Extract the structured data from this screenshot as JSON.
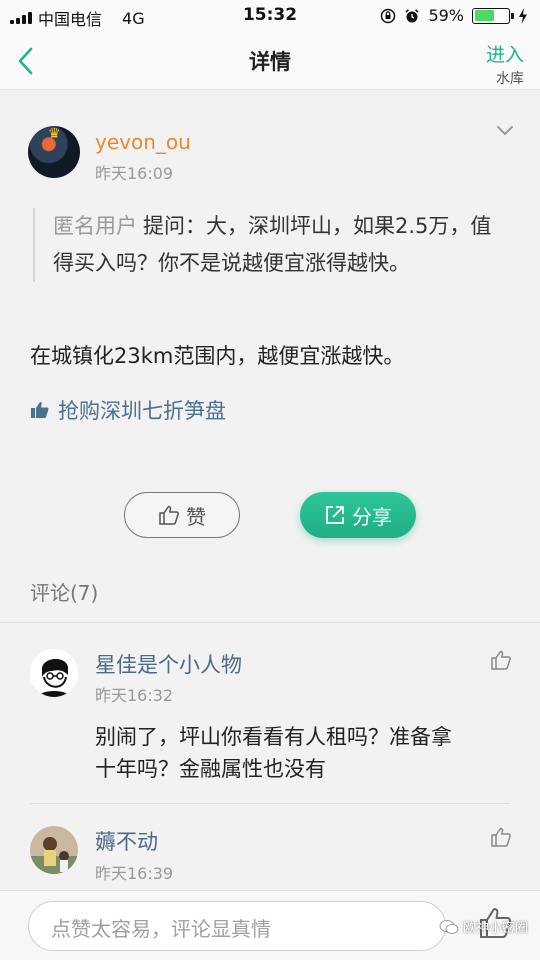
{
  "status_bar": {
    "carrier": "中国电信",
    "network": "4G",
    "time": "15:32",
    "battery": "59%",
    "battery_level": 0.59
  },
  "nav": {
    "title": "详情",
    "enter_label": "进入",
    "enter_sub": "水库"
  },
  "post": {
    "username": "yevon_ou",
    "time": "昨天16:09",
    "quote_author": "匿名用户",
    "quote_text": "提问：大，深圳坪山，如果2.5万，值得买入吗？你不是说越便宜涨得越快。",
    "answer": "在城镇化23km范围内，越便宜涨越快。",
    "promo": "抢购深圳七折笋盘",
    "like_label": "赞",
    "share_label": "分享"
  },
  "comments_header": "评论(7)",
  "comments": [
    {
      "name": "星佳是个小人物",
      "time": "昨天16:32",
      "body": "别闹了，坪山你看看有人租吗？准备拿十年吗？金融属性也没有"
    },
    {
      "name": "薅不动",
      "time": "昨天16:39"
    }
  ],
  "bottom": {
    "placeholder": "点赞太容易，评论显真情",
    "watermark": "欧神小密圈"
  },
  "colors": {
    "accent": "#20b48a",
    "username": "#e88a2c",
    "link": "#4b7090"
  }
}
